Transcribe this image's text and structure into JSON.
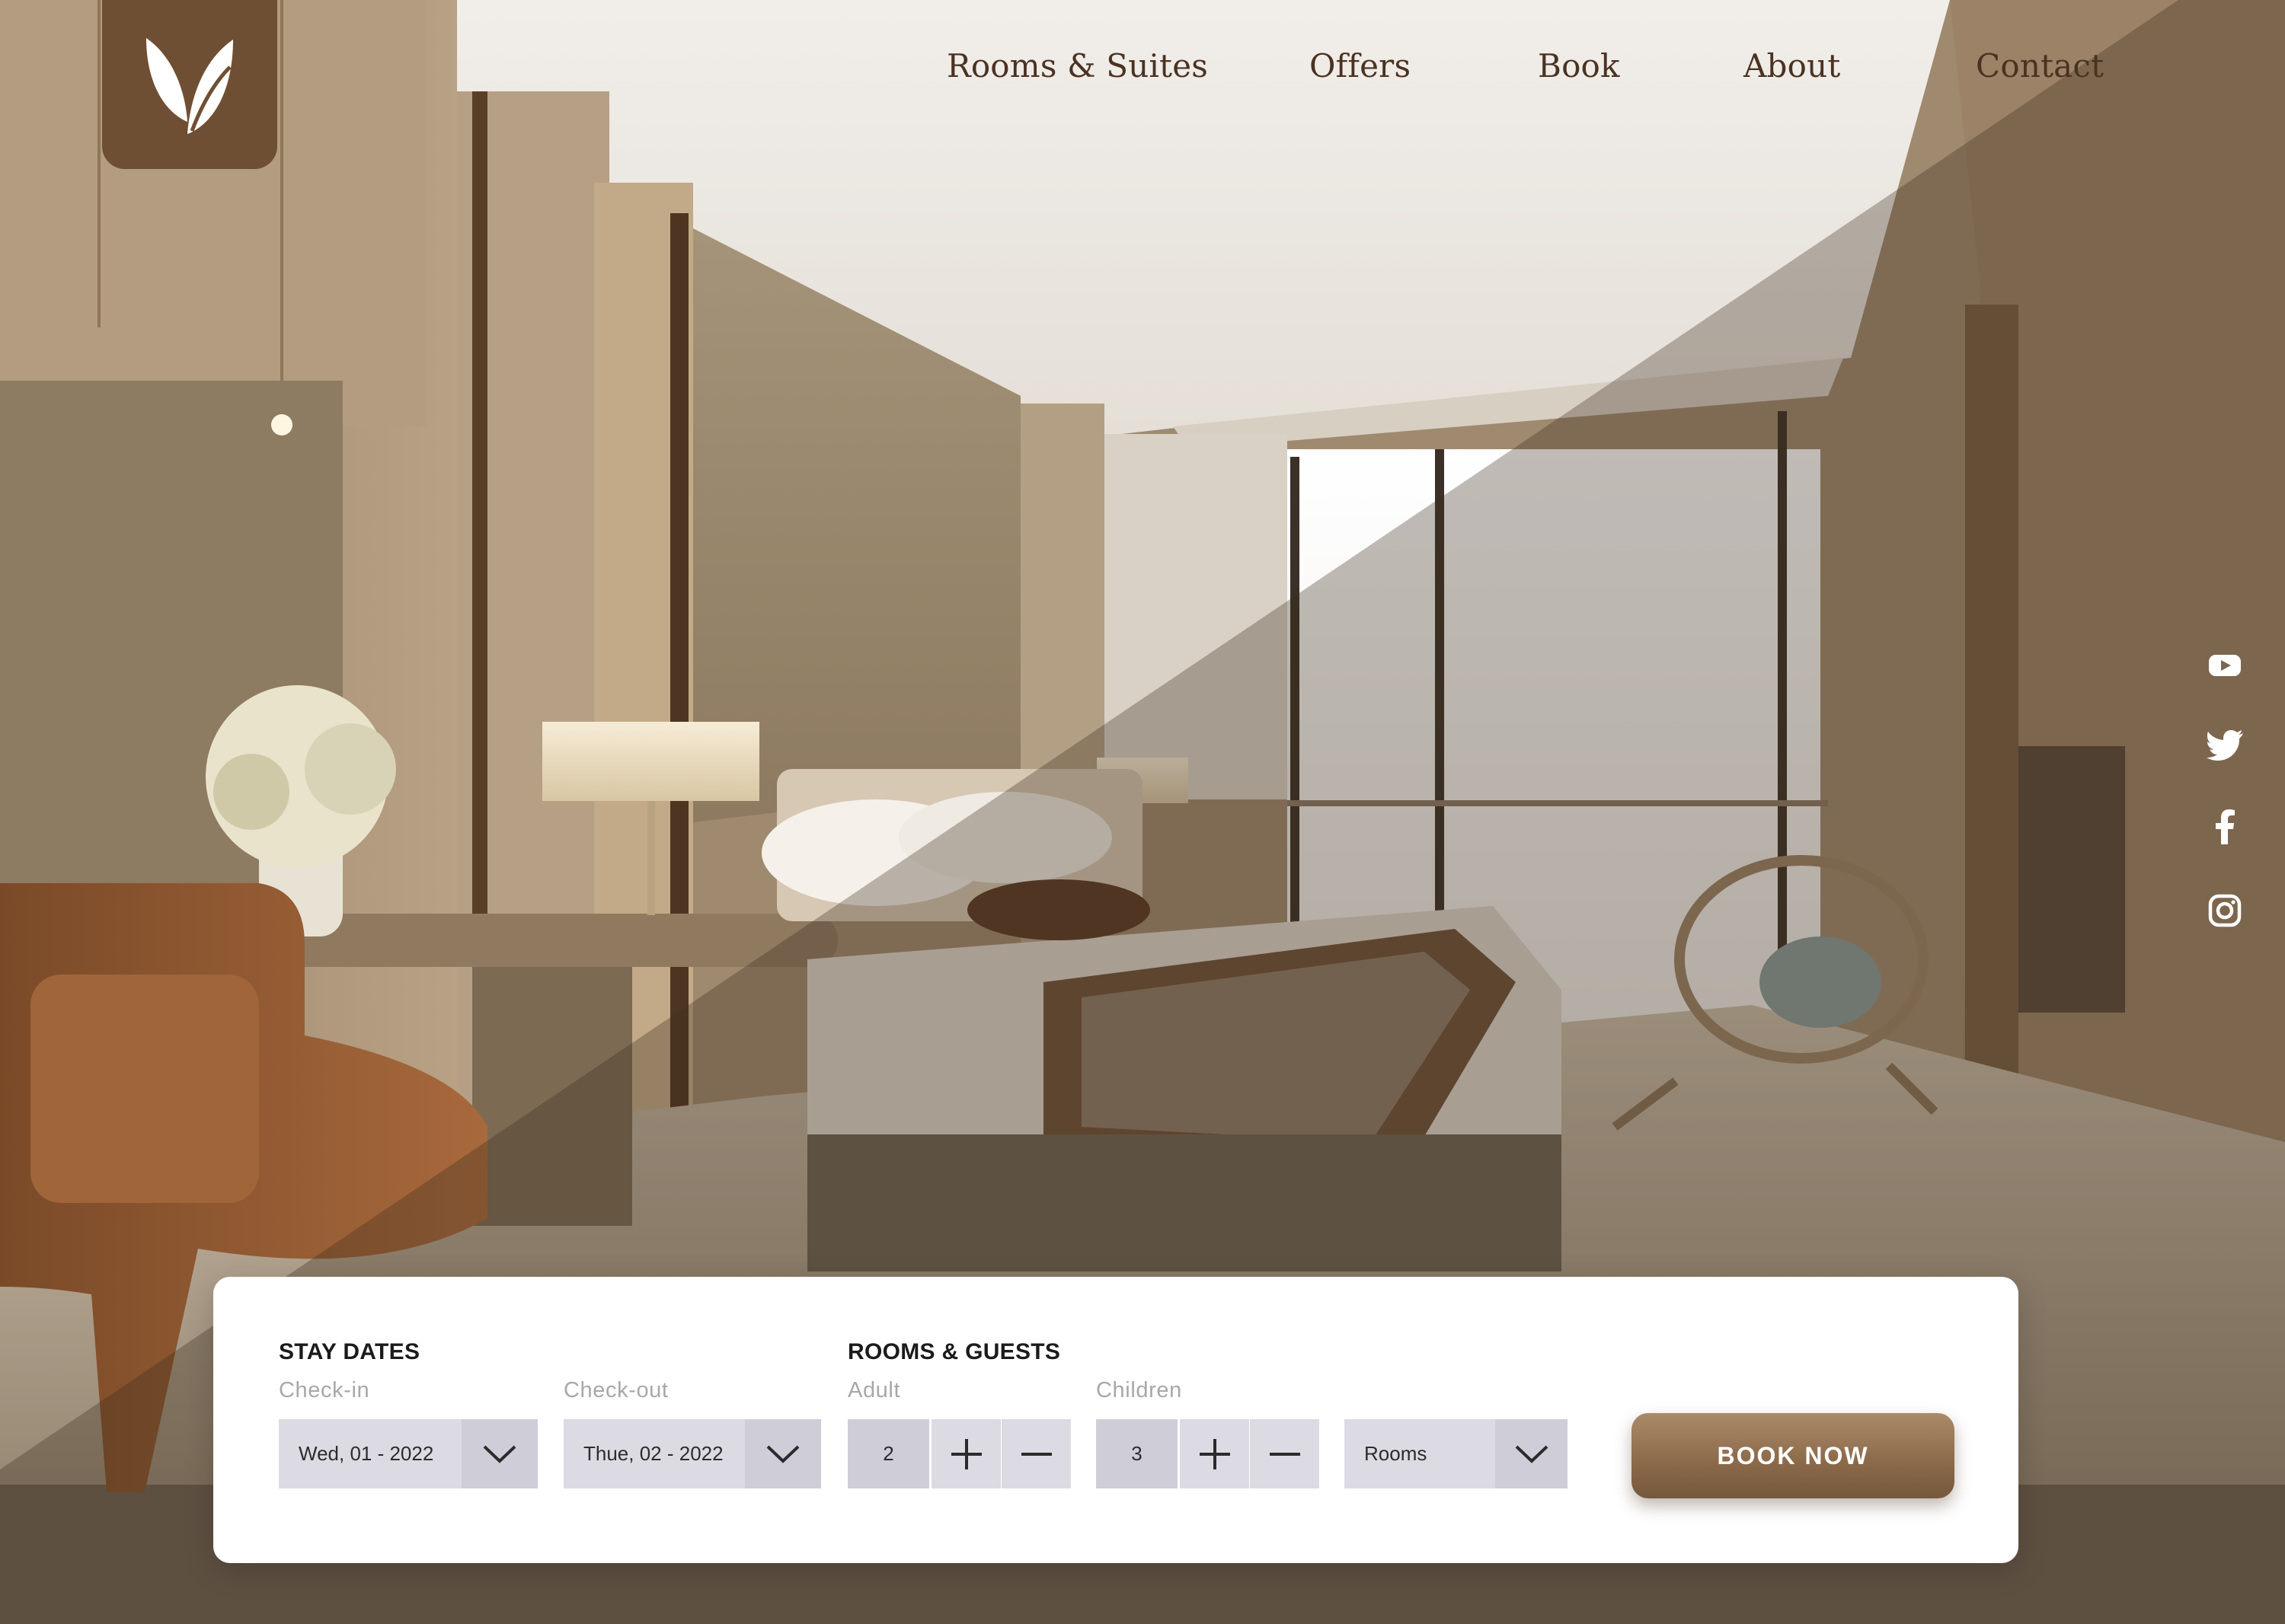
{
  "brand": {
    "logo_icon": "leaf-logo-icon",
    "color": "#6f4f33"
  },
  "nav": {
    "items": [
      {
        "label": "Rooms & Suites"
      },
      {
        "label": "Offers"
      },
      {
        "label": "Book"
      },
      {
        "label": "About"
      },
      {
        "label": "Contact"
      }
    ]
  },
  "social": [
    "youtube-icon",
    "twitter-icon",
    "facebook-icon",
    "instagram-icon"
  ],
  "booking": {
    "stay_dates": {
      "title": "STAY DATES",
      "checkin_label": "Check-in",
      "checkin_value": "Wed, 01 - 2022",
      "checkout_label": "Check-out",
      "checkout_value": "Thue, 02 - 2022"
    },
    "rooms_guests": {
      "title": "ROOMS & GUESTS",
      "adult_label": "Adult",
      "adult_value": "2",
      "children_label": "Children",
      "children_value": "3",
      "rooms_value": "Rooms"
    },
    "book_now_label": "BOOK NOW"
  },
  "colors": {
    "accent": "#8a6949",
    "nav_text": "#4a3222",
    "field_bg": "#dcdbe3",
    "field_bg_dark": "#cfcdd8"
  }
}
